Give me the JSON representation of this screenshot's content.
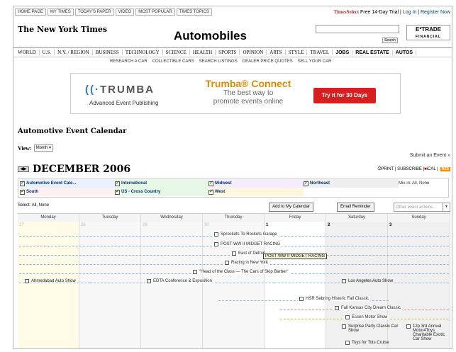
{
  "topnav": {
    "links": [
      "HOME PAGE",
      "MY TIMES",
      "TODAY'S PAPER",
      "VIDEO",
      "MOST POPULAR",
      "TIMES TOPICS"
    ],
    "times_select": "TimesSelect",
    "trial": "Free 14-Day Trial",
    "login": "Log In",
    "register": "Register Now"
  },
  "header": {
    "logo": "The New York Times",
    "section": "Automobiles",
    "search_button": "Search",
    "sponsor": "E*TRADE",
    "sponsor_sub": "FINANCIAL"
  },
  "nav": {
    "primary": [
      "WORLD",
      "U.S.",
      "N.Y. / REGION",
      "BUSINESS",
      "TECHNOLOGY",
      "SCIENCE",
      "HEALTH",
      "SPORTS",
      "OPINION",
      "ARTS",
      "STYLE",
      "TRAVEL",
      "JOBS",
      "REAL ESTATE",
      "AUTOS"
    ],
    "secondary": [
      "RESEARCH A CAR",
      "COLLECTIBLE CARS",
      "SEARCH LISTINGS",
      "DEALER PRICE QUOTES",
      "SELL YOUR CAR"
    ]
  },
  "ad": {
    "brand": "TRUMBA",
    "brand_sub": "Advanced Event Publishing",
    "headline": "Trumba® Connect",
    "line1": "The best way to",
    "line2": "promote events online",
    "cta": "Try it for 30 Days"
  },
  "calendar": {
    "title": "Automotive Event Calendar",
    "view_label": "View:",
    "view_value": "Month",
    "submit": "Submit an Event »",
    "month": "DECEMBER 2006",
    "print_links": "PRINT | SUBSCRIBE | ",
    "ical": "iCAL |",
    "rss": "RSS",
    "filters": [
      {
        "label": "Automotive Event Cale...",
        "checked": true
      },
      {
        "label": "International",
        "checked": true
      },
      {
        "label": "Midwest",
        "checked": true
      },
      {
        "label": "Northeast",
        "checked": true
      },
      {
        "label": "South",
        "checked": true
      },
      {
        "label": "US - Cross Country",
        "checked": true
      },
      {
        "label": "West",
        "checked": true
      }
    ],
    "mixin": "Mix-in: All, None",
    "select_text": "Select: All, None",
    "add_button": "Add to My Calendar",
    "email_button": "Email Reminder",
    "other_actions": "Other event actions...",
    "days": [
      "Monday",
      "Tuesday",
      "Wednesday",
      "Thursday",
      "Friday",
      "Saturday",
      "Sunday"
    ],
    "day_numbers": [
      "27",
      "28",
      "29",
      "30",
      "1",
      "2",
      "3"
    ],
    "events": [
      "Sprockets To Rockets Garage",
      "POST-WW II MIDGET RACING",
      "East of Detroit",
      "Racing in New York",
      "\"Head of the Class — The Cars of Skip Barber\"",
      "Ahmedabad Auto Show",
      "EDTA Conference & Exposition",
      "Los Angeles Auto Show",
      "HSR Sebring Historic Fall Classic",
      "Fall Kansas City Dream Classic",
      "Essen Motor Show",
      "Surprise Party Classic Car Show",
      "12p 3rd Annual Motor4Toys Charitable Exotic Car Show",
      "Toys for Tots Cruise"
    ],
    "tooltip": "POST-WW II MIDGET RACING"
  }
}
